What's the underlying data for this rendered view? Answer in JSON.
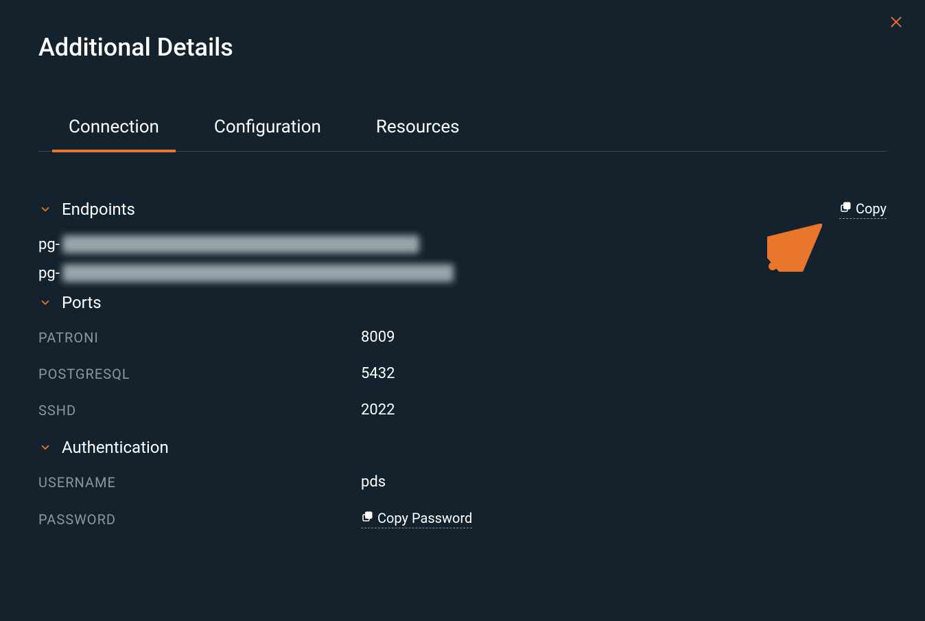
{
  "header": {
    "title": "Additional Details"
  },
  "tabs": [
    {
      "label": "Connection",
      "active": true
    },
    {
      "label": "Configuration",
      "active": false
    },
    {
      "label": "Resources",
      "active": false
    }
  ],
  "sections": {
    "endpoints": {
      "title": "Endpoints",
      "copy_label": "Copy",
      "items": [
        {
          "prefix": "pg-"
        },
        {
          "prefix": "pg-"
        }
      ]
    },
    "ports": {
      "title": "Ports",
      "rows": [
        {
          "key": "PATRONI",
          "value": "8009"
        },
        {
          "key": "POSTGRESQL",
          "value": "5432"
        },
        {
          "key": "SSHD",
          "value": "2022"
        }
      ]
    },
    "auth": {
      "title": "Authentication",
      "rows": [
        {
          "key": "USERNAME",
          "value": "pds"
        },
        {
          "key": "PASSWORD",
          "copy_label": "Copy Password"
        }
      ]
    }
  }
}
